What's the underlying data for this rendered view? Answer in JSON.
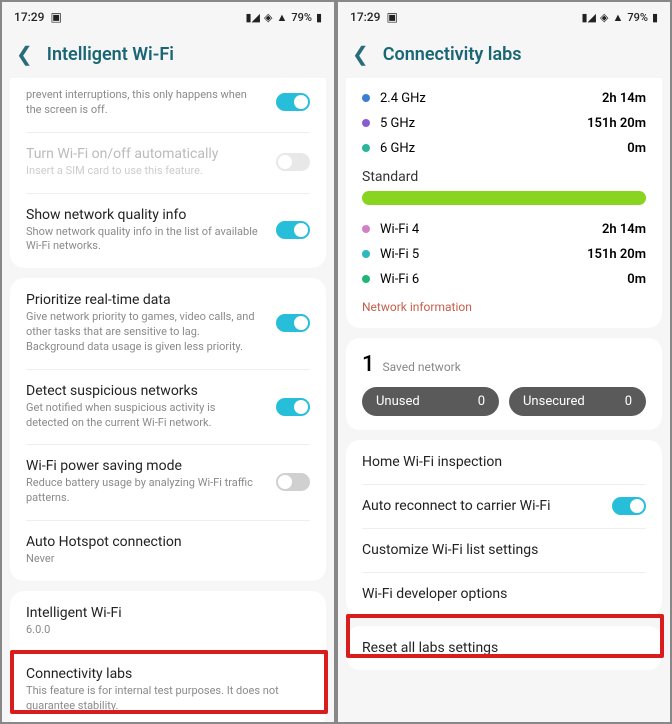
{
  "statusbar": {
    "time": "17:29",
    "battery": "79%"
  },
  "left": {
    "title": "Intelligent Wi-Fi",
    "partial": "prevent interruptions, this only happens when the screen is off.",
    "auto": {
      "title": "Turn Wi-Fi on/off automatically",
      "sub": "Insert a SIM card to use this feature."
    },
    "quality": {
      "title": "Show network quality info",
      "sub": "Show network quality info in the list of available Wi-Fi networks."
    },
    "prioritize": {
      "title": "Prioritize real-time data",
      "sub": "Give network priority to games, video calls, and other tasks that are sensitive to lag. Background data usage is given less priority."
    },
    "suspicious": {
      "title": "Detect suspicious networks",
      "sub": "Get notified when suspicious activity is detected on the current Wi-Fi network."
    },
    "power": {
      "title": "Wi-Fi power saving mode",
      "sub": "Reduce battery usage by analyzing Wi-Fi traffic patterns."
    },
    "hotspot": {
      "title": "Auto Hotspot connection",
      "sub": "Never"
    },
    "intel": {
      "title": "Intelligent Wi-Fi",
      "sub": "6.0.0"
    },
    "labs": {
      "title": "Connectivity labs",
      "sub": "This feature is for internal test purposes. It does not guarantee stability."
    }
  },
  "right": {
    "title": "Connectivity labs",
    "freq": [
      {
        "label": "2.4 GHz",
        "time": "2h 14m",
        "color": "#3b7fd4"
      },
      {
        "label": "5 GHz",
        "time": "151h 20m",
        "color": "#8a5cd4"
      },
      {
        "label": "6 GHz",
        "time": "0m",
        "color": "#2bb59a"
      }
    ],
    "standard_label": "Standard",
    "wifi": [
      {
        "label": "Wi-Fi 4",
        "time": "2h 14m",
        "color": "#d47fc5"
      },
      {
        "label": "Wi-Fi 5",
        "time": "151h 20m",
        "color": "#2db8bd"
      },
      {
        "label": "Wi-Fi 6",
        "time": "0m",
        "color": "#21b573"
      }
    ],
    "net_info": "Network information",
    "saved": {
      "count": "1",
      "label": "Saved network"
    },
    "pills": {
      "unused": "Unused",
      "unused_n": "0",
      "unsecured": "Unsecured",
      "unsecured_n": "0"
    },
    "items": {
      "home": "Home Wi-Fi inspection",
      "auto": "Auto reconnect to carrier Wi-Fi",
      "customize": "Customize Wi-Fi list settings",
      "dev": "Wi-Fi developer options",
      "reset": "Reset all labs settings"
    }
  }
}
